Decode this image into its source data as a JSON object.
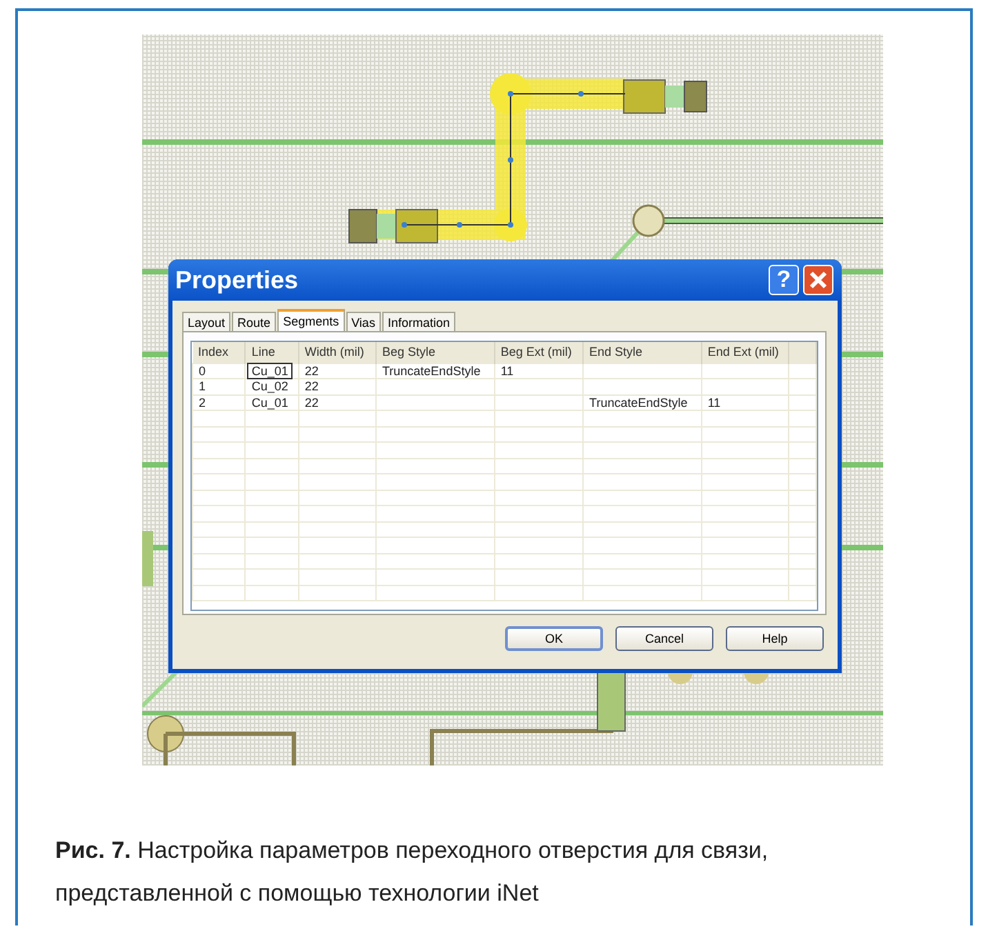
{
  "dialog": {
    "title": "Properties",
    "help_button": "?",
    "tabs": [
      {
        "label": "Layout",
        "selected": false
      },
      {
        "label": "Route",
        "selected": false
      },
      {
        "label": "Segments",
        "selected": true
      },
      {
        "label": "Vias",
        "selected": false
      },
      {
        "label": "Information",
        "selected": false
      }
    ],
    "table": {
      "columns": [
        "Index",
        "Line",
        "Width (mil)",
        "Beg Style",
        "Beg Ext (mil)",
        "End Style",
        "End Ext (mil)"
      ],
      "rows": [
        {
          "focused": true,
          "cells": [
            "0",
            "Cu_01",
            "22",
            "TruncateEndStyle",
            "11",
            "",
            ""
          ]
        },
        {
          "focused": false,
          "cells": [
            "1",
            "Cu_02",
            "22",
            "",
            "",
            "",
            ""
          ]
        },
        {
          "focused": false,
          "cells": [
            "2",
            "Cu_01",
            "22",
            "",
            "",
            "TruncateEndStyle",
            "11"
          ]
        }
      ]
    },
    "buttons": [
      {
        "label": "OK",
        "default": true
      },
      {
        "label": "Cancel",
        "default": false
      },
      {
        "label": "Help",
        "default": false
      }
    ]
  },
  "caption": "**Рис. 7.** Настройка параметров переходного отверстия для связи, представленной с помощью технологии iNet"
}
